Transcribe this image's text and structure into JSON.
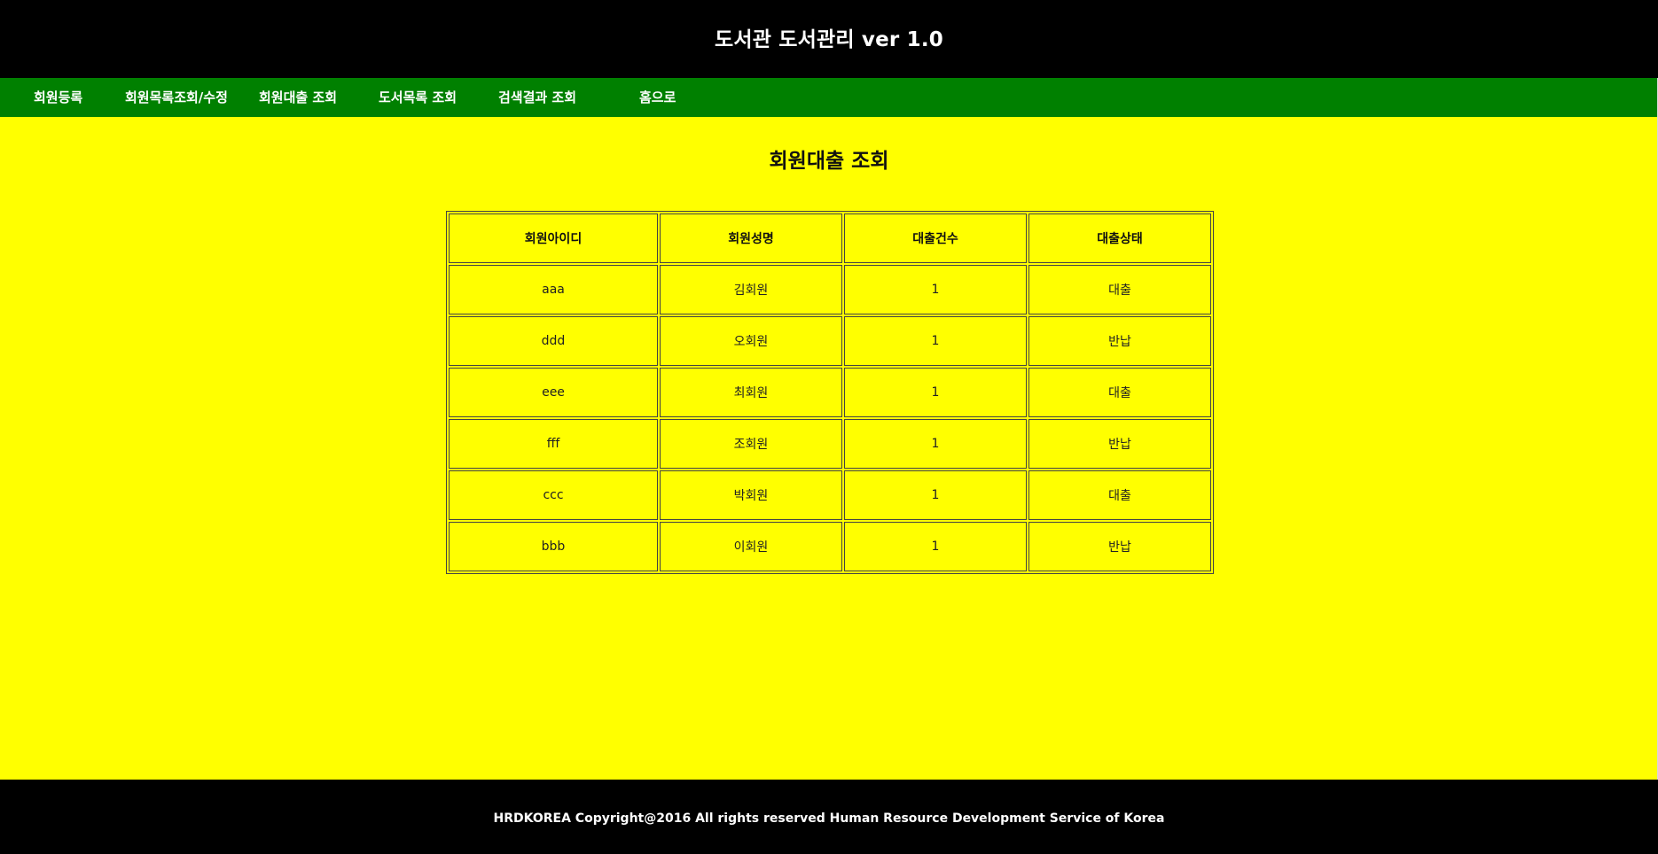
{
  "header": {
    "title": "도서관 도서관리 ver 1.0"
  },
  "nav": {
    "items": [
      {
        "label": "회원등록"
      },
      {
        "label": "회원목록조회/수정"
      },
      {
        "label": "회원대출 조회"
      },
      {
        "label": "도서목록 조회"
      },
      {
        "label": "검색결과 조회"
      },
      {
        "label": "홈으로"
      }
    ]
  },
  "main": {
    "title": "회원대출 조회",
    "table": {
      "columns": [
        "회원아이디",
        "회원성명",
        "대출건수",
        "대출상태"
      ],
      "rows": [
        [
          "aaa",
          "김회원",
          "1",
          "대출"
        ],
        [
          "ddd",
          "오회원",
          "1",
          "반납"
        ],
        [
          "eee",
          "최회원",
          "1",
          "대출"
        ],
        [
          "fff",
          "조회원",
          "1",
          "반납"
        ],
        [
          "ccc",
          "박회원",
          "1",
          "대출"
        ],
        [
          "bbb",
          "이회원",
          "1",
          "반납"
        ]
      ]
    }
  },
  "footer": {
    "text": "HRDKOREA Copyright@2016 All rights reserved Human Resource Development Service of Korea"
  },
  "colors": {
    "header_bg": "#000000",
    "nav_bg": "#008000",
    "content_bg": "#ffff00",
    "footer_bg": "#000000"
  }
}
